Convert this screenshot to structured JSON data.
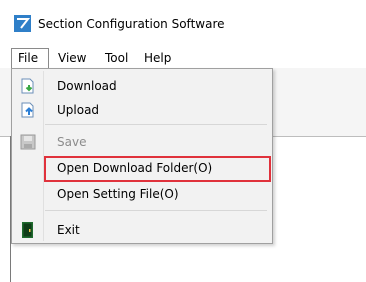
{
  "window": {
    "title": "Section Configuration Software"
  },
  "menubar": {
    "items": [
      {
        "label": "File"
      },
      {
        "label": "View"
      },
      {
        "label": "Tool"
      },
      {
        "label": "Help"
      }
    ]
  },
  "file_menu": {
    "items": [
      {
        "label": "Download",
        "icon": "download-icon",
        "enabled": true
      },
      {
        "label": "Upload",
        "icon": "upload-icon",
        "enabled": true
      },
      {
        "label": "Save",
        "icon": "save-icon",
        "enabled": false
      },
      {
        "label": "Open Download Folder(O)",
        "icon": "",
        "enabled": true,
        "highlighted": true
      },
      {
        "label": "Open Setting File(O)",
        "icon": "",
        "enabled": true
      },
      {
        "label": "Exit",
        "icon": "exit-icon",
        "enabled": true
      }
    ]
  },
  "colors": {
    "highlight_border": "#e0323c",
    "app_icon": "#2f7fc8",
    "download_arrow": "#3aa845",
    "upload_arrow": "#2c7fd6",
    "exit_icon": "#1f6b2e"
  }
}
